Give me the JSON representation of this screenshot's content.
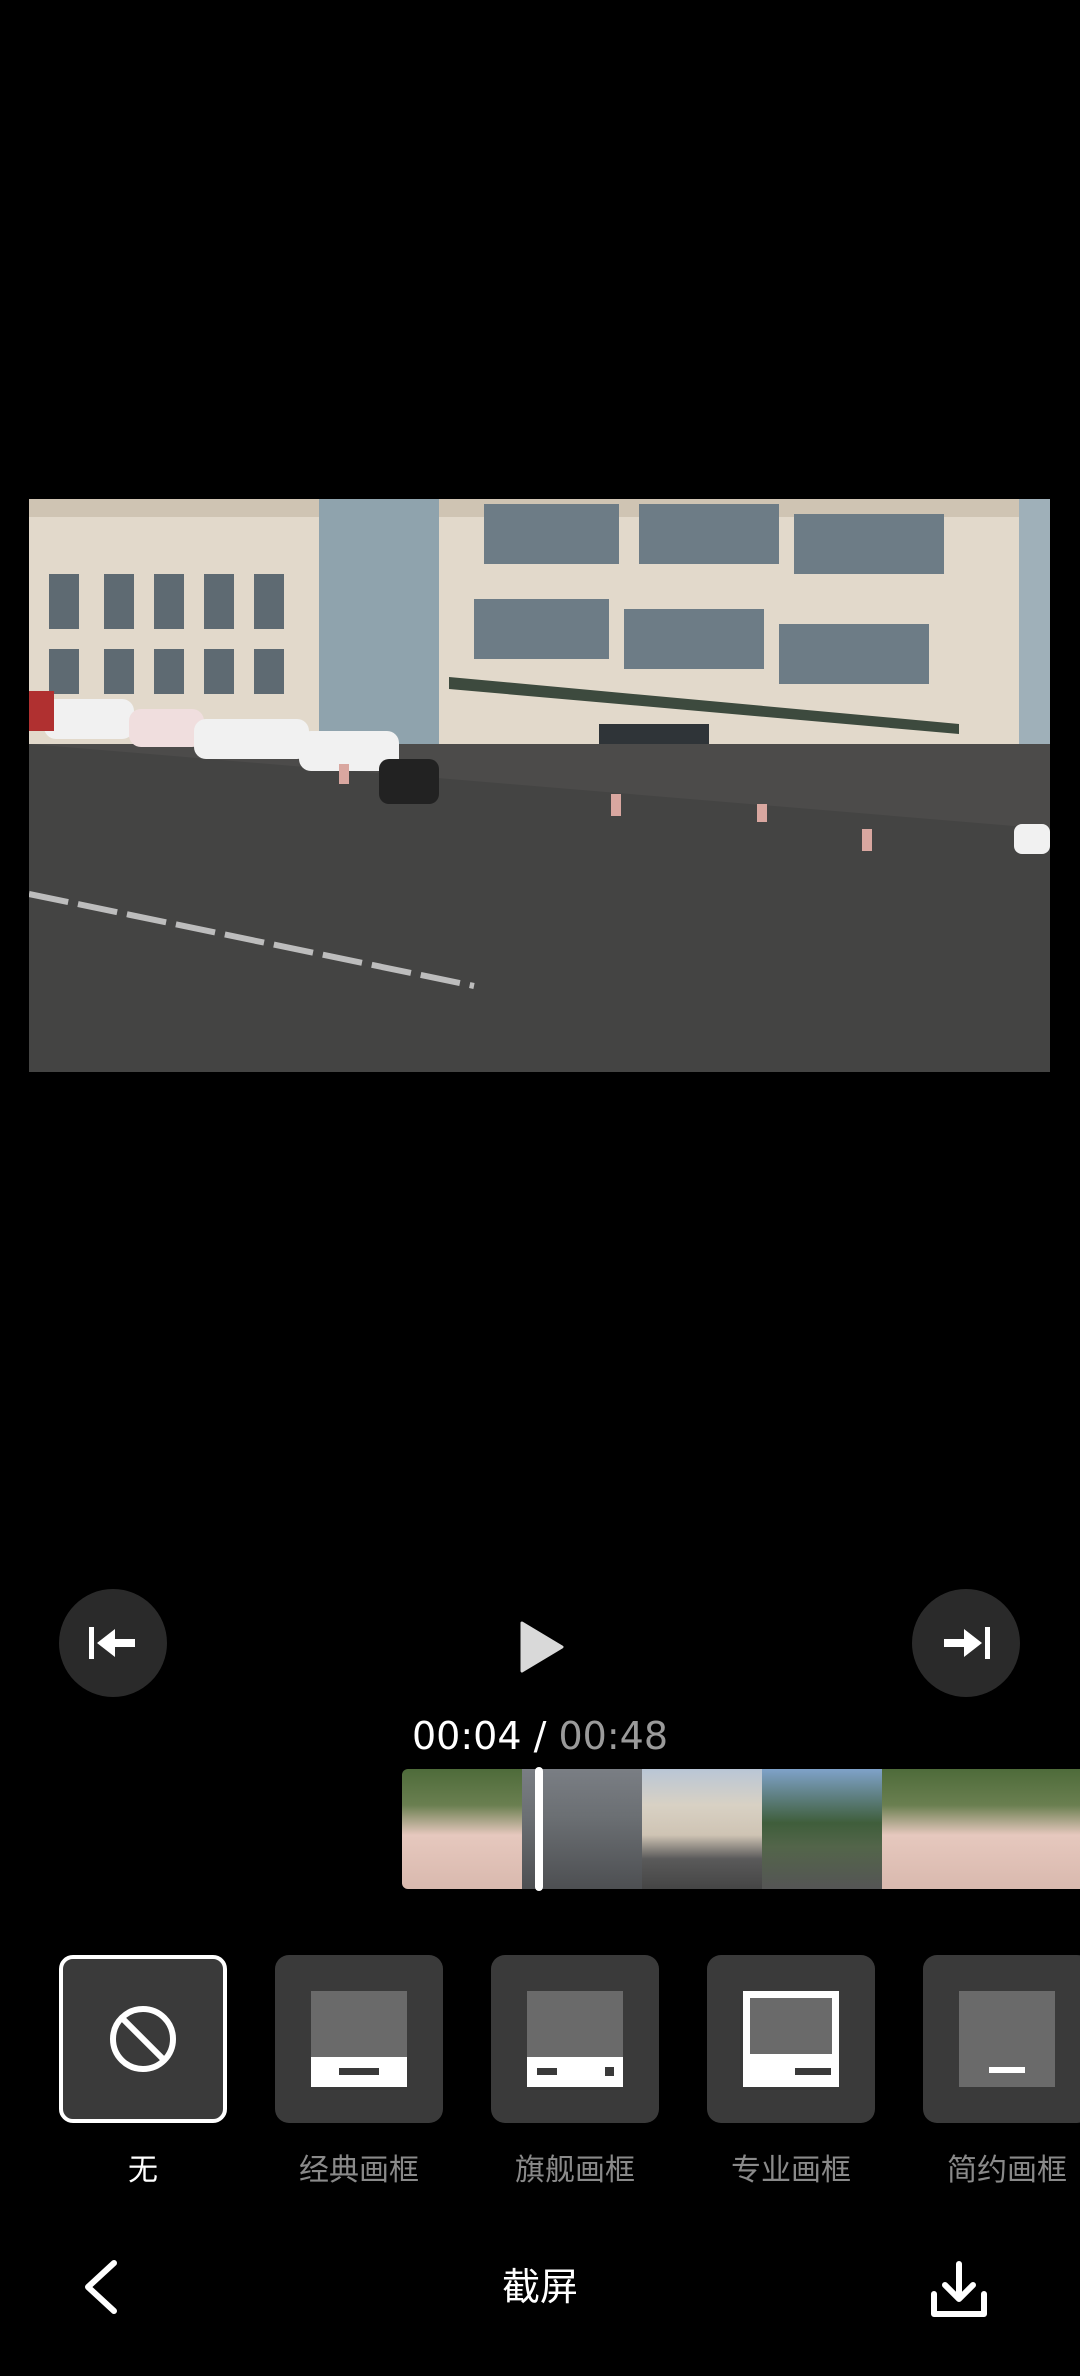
{
  "player": {
    "current_time": "00:04",
    "separator": " / ",
    "total_time": "00:48"
  },
  "frames": [
    {
      "label": "无",
      "selected": true
    },
    {
      "label": "经典画框",
      "selected": false
    },
    {
      "label": "旗舰画框",
      "selected": false
    },
    {
      "label": "专业画框",
      "selected": false
    },
    {
      "label": "简约画框",
      "selected": false
    }
  ],
  "bottom_bar": {
    "title": "截屏"
  },
  "icons": {
    "back": "chevron-left-icon",
    "download": "download-icon",
    "play": "play-icon",
    "jump_start": "jump-start-icon",
    "jump_end": "jump-end-icon",
    "none": "prohibit-icon"
  },
  "colors": {
    "background": "#000000",
    "button_bg": "#2a2a2a",
    "tile_bg": "#3a3a3a",
    "muted_text": "#8a8a8a"
  }
}
